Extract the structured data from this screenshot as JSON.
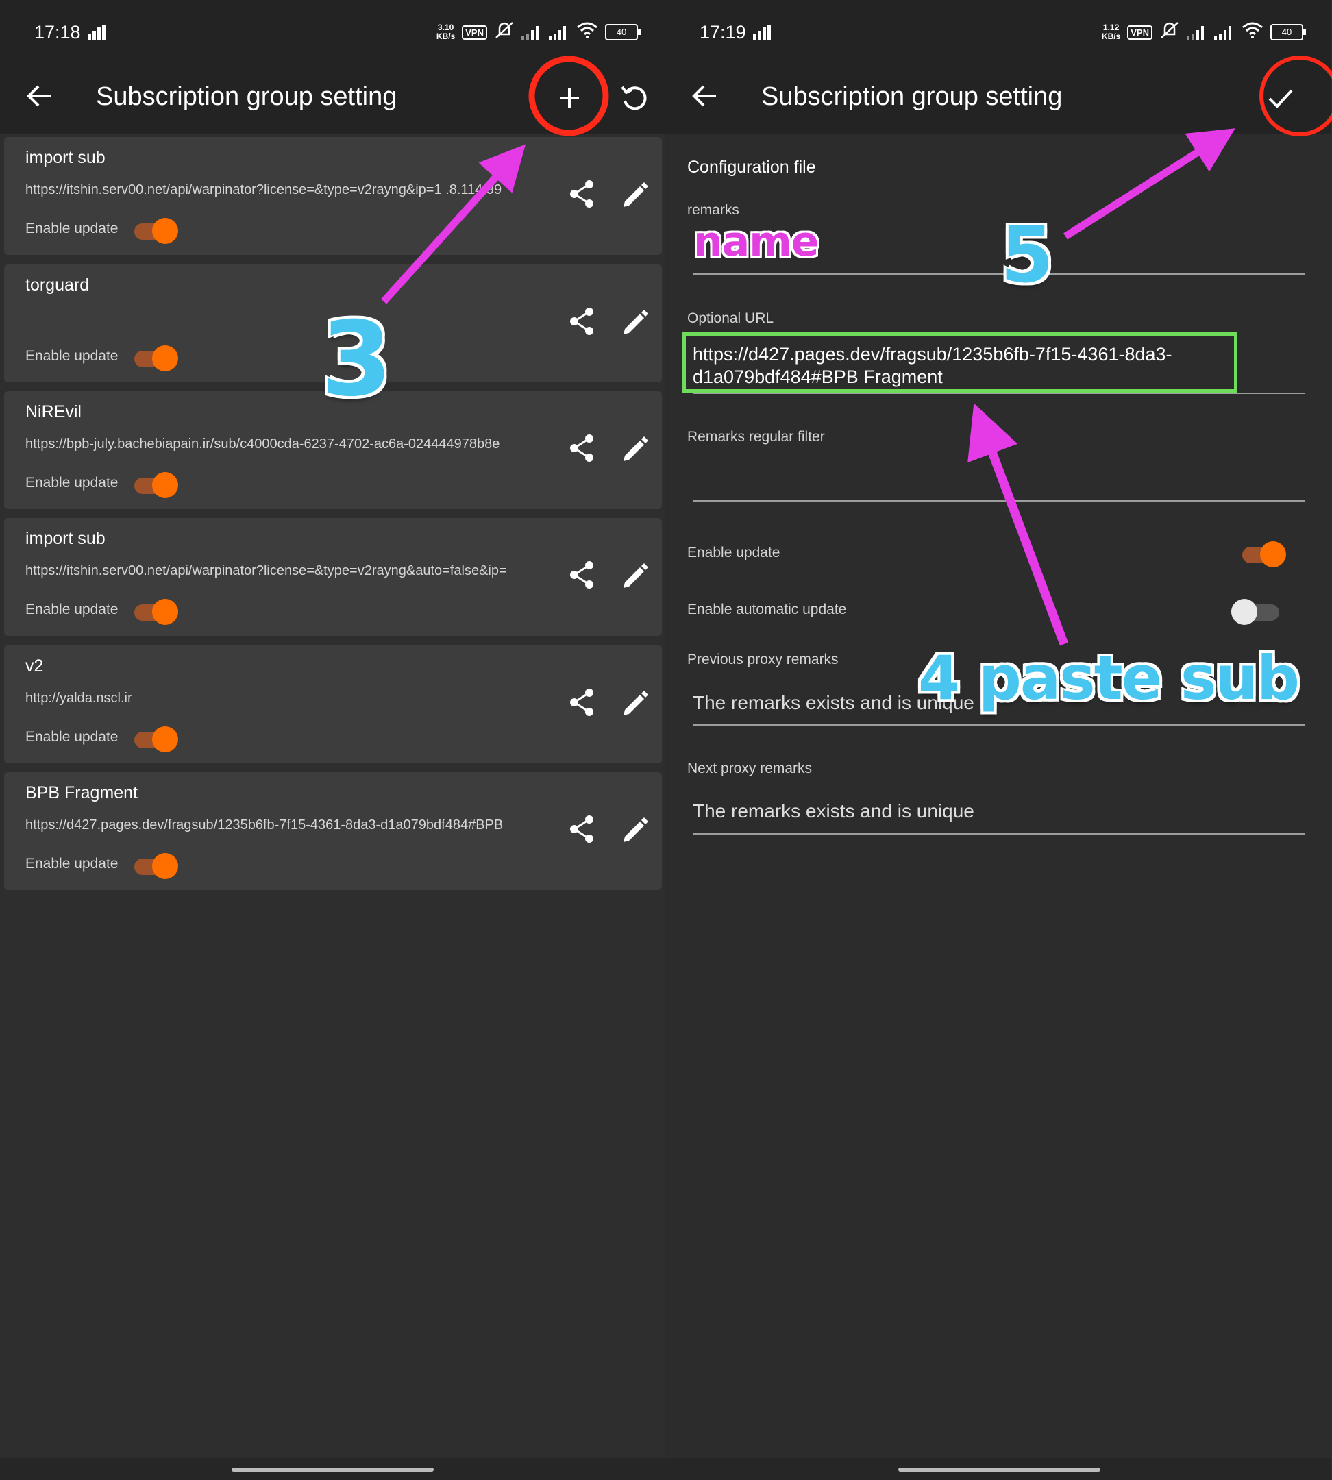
{
  "left": {
    "status": {
      "time": "17:18",
      "speed_value": "3.10",
      "speed_unit": "KB/s",
      "vpn": "VPN",
      "battery": "40"
    },
    "appbar": {
      "title": "Subscription group setting"
    },
    "cards": [
      {
        "name": "import sub",
        "url": "https://itshin.serv00.net/api/warpinator?license=&type=v2rayng&ip=1 .8.114.99",
        "enable_label": "Enable update",
        "enabled": true
      },
      {
        "name": "torguard",
        "url": "",
        "enable_label": "Enable update",
        "enabled": true
      },
      {
        "name": "NiREvil",
        "url": "https://bpb-july.bachebiapain.ir/sub/c4000cda-6237-4702-ac6a-024444978b8e",
        "enable_label": "Enable update",
        "enabled": true
      },
      {
        "name": "import sub",
        "url": "https://itshin.serv00.net/api/warpinator?license=&type=v2rayng&auto=false&ip=",
        "enable_label": "Enable update",
        "enabled": true
      },
      {
        "name": "v2",
        "url": "http://yalda.nscl.ir",
        "enable_label": "Enable update",
        "enabled": true
      },
      {
        "name": "BPB Fragment",
        "url": "https://d427.pages.dev/fragsub/1235b6fb-7f15-4361-8da3-d1a079bdf484#BPB",
        "enable_label": "Enable update",
        "enabled": true
      }
    ]
  },
  "right": {
    "status": {
      "time": "17:19",
      "speed_value": "1.12",
      "speed_unit": "KB/s",
      "vpn": "VPN",
      "battery": "40"
    },
    "appbar": {
      "title": "Subscription group setting"
    },
    "form": {
      "section_title": "Configuration file",
      "remarks_label": "remarks",
      "url_label": "Optional URL",
      "url_value": "https://d427.pages.dev/fragsub/1235b6fb-7f15-4361-8da3-d1a079bdf484#BPB Fragment",
      "filter_label": "Remarks regular filter",
      "enable_update_label": "Enable update",
      "enable_update": true,
      "auto_update_label": "Enable automatic update",
      "auto_update": false,
      "prev_label": "Previous proxy remarks",
      "prev_value": "The remarks exists and is unique",
      "next_label": "Next proxy remarks",
      "next_value": "The remarks exists and is unique"
    }
  },
  "annotations": {
    "step3": "3",
    "step4": "4 paste sub",
    "step5": "5",
    "name_hint": "name",
    "arrow_color": "#e43be6",
    "circle_color": "#ff2a1a",
    "box_color": "#6fdc5a"
  },
  "colors": {
    "accent": "#ff6f00",
    "bg": "#2e2e2e",
    "card": "#3d3d3d",
    "bar": "#232323"
  }
}
